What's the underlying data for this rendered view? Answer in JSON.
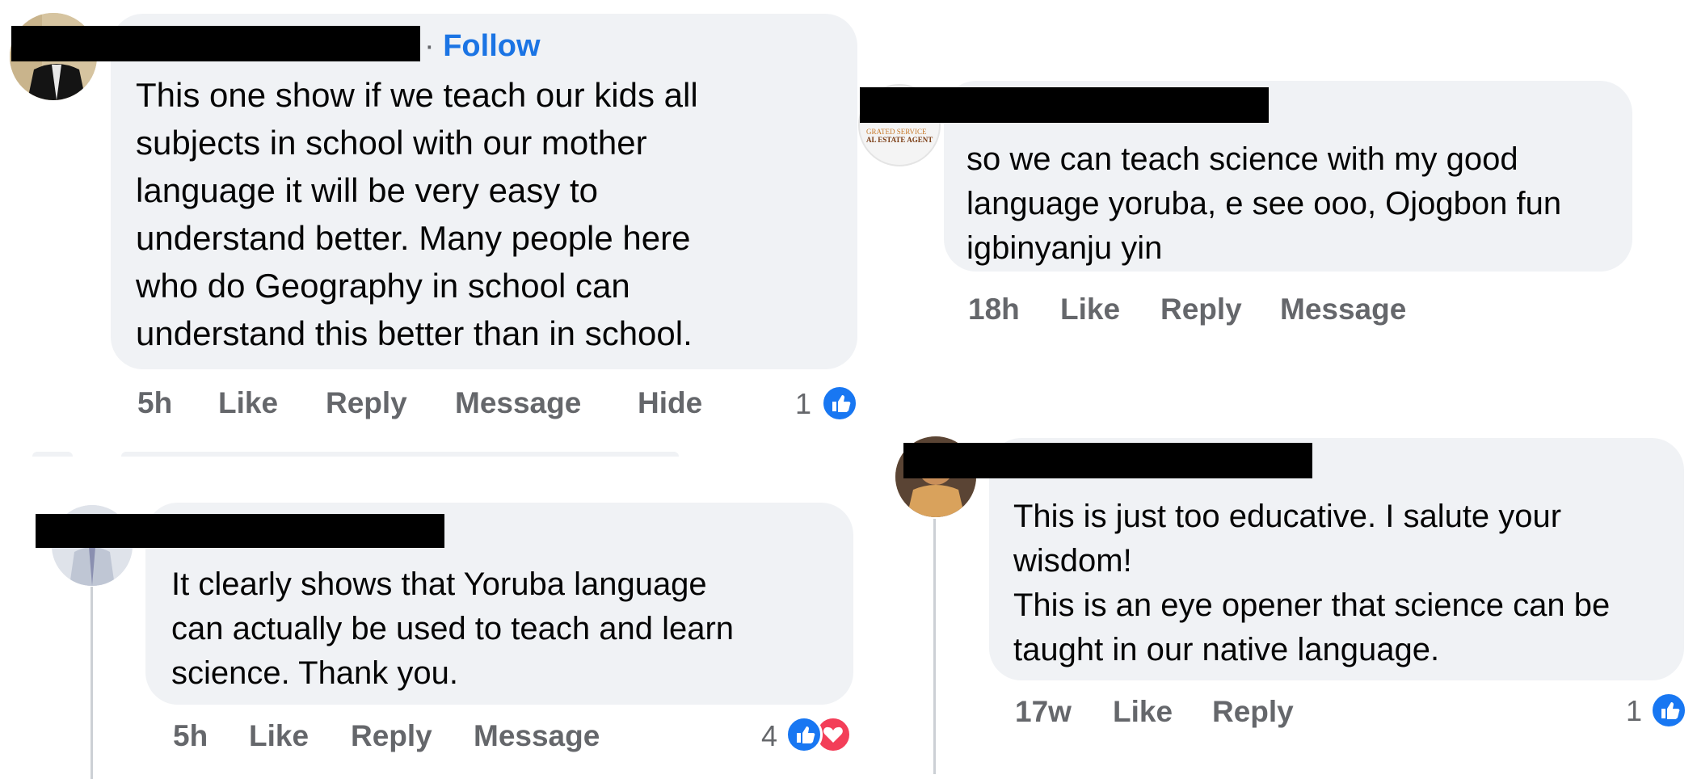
{
  "colors": {
    "bubble": "#f0f2f5",
    "action_text": "#65676b",
    "follow": "#1b74e4",
    "like": "#1877f2",
    "love": "#f33e58"
  },
  "comment1": {
    "follow_label": "Follow",
    "text": [
      "This one show if we teach our kids all",
      "subjects in school with our mother",
      "language it will be very easy to",
      "understand better.  Many people here",
      "who do Geography in school can",
      "understand this better than in school."
    ],
    "time": "5h",
    "like": "Like",
    "reply": "Reply",
    "message": "Message",
    "hide": "Hide",
    "reaction_count": "1",
    "reaction_icons": [
      "like-icon"
    ]
  },
  "comment2": {
    "avatar_text": [
      "GRATED SERVICE",
      "AL ESTATE AGENT"
    ],
    "text": [
      "so we can teach science with my good",
      "language yoruba, e see ooo, Ojogbon fun",
      "igbinyanju yin"
    ],
    "time": "18h",
    "like": "Like",
    "reply": "Reply",
    "message": "Message"
  },
  "comment3": {
    "text": [
      "It clearly shows that Yoruba language",
      "can actually be used to teach and learn",
      "science. Thank you."
    ],
    "time": "5h",
    "like": "Like",
    "reply": "Reply",
    "message": "Message",
    "reaction_count": "4",
    "reaction_icons": [
      "like-icon",
      "love-icon"
    ]
  },
  "comment4": {
    "text": [
      "This is just too educative. I salute your",
      "wisdom!",
      "This is an eye opener that science can be",
      "taught in our native language."
    ],
    "time": "17w",
    "like": "Like",
    "reply": "Reply",
    "reaction_count": "1",
    "reaction_icons": [
      "like-icon"
    ]
  }
}
